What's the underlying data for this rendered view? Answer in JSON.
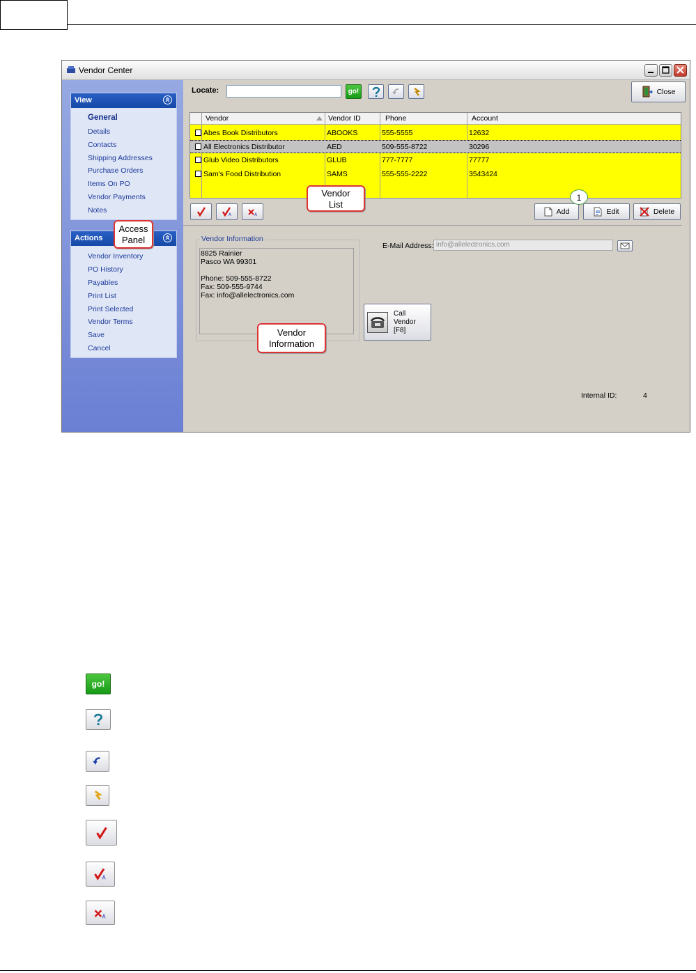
{
  "window": {
    "title": "Vendor Center"
  },
  "view_panel": {
    "title": "View",
    "items": [
      "General",
      "Details",
      "Contacts",
      "Shipping Addresses",
      "Purchase Orders",
      "Items On PO",
      "Vendor Payments",
      "Notes"
    ]
  },
  "actions_panel": {
    "title": "Actions",
    "items": [
      "Vendor Inventory",
      "PO History",
      "Payables",
      "Print List",
      "Print Selected",
      "Vendor Terms",
      "Save",
      "Cancel"
    ]
  },
  "toolbar": {
    "locate_label": "Locate:",
    "locate_value": "",
    "go_label": "go!",
    "close_label": "Close"
  },
  "vendor_grid": {
    "columns": [
      "Vendor",
      "Vendor ID",
      "Phone",
      "Account"
    ],
    "rows": [
      {
        "vendor": "Abes Book Distributors",
        "vendor_id": "ABOOKS",
        "phone": "555-5555",
        "account": "12632"
      },
      {
        "vendor": "All Electronics Distributor",
        "vendor_id": "AED",
        "phone": "509-555-8722",
        "account": "30296"
      },
      {
        "vendor": "Glub Video Distributors",
        "vendor_id": "GLUB",
        "phone": "777-7777",
        "account": "77777"
      },
      {
        "vendor": "Sam's Food Distribution",
        "vendor_id": "SAMS",
        "phone": "555-555-2222",
        "account": "3543424"
      }
    ]
  },
  "grid_buttons": {
    "add": "Add",
    "edit": "Edit",
    "delete": "Delete"
  },
  "vendor_info": {
    "legend": "Vendor Information",
    "lines": [
      "8825 Rainier",
      "Pasco WA 99301",
      "",
      "Phone: 509-555-8722",
      "Fax: 509-555-9744",
      "Fax: info@allelectronics.com"
    ]
  },
  "email": {
    "label": "E-Mail Address:",
    "value": "info@allelectronics.com"
  },
  "call_button": {
    "lines": [
      "Call",
      "Vendor",
      "[F8]"
    ]
  },
  "internal_id": {
    "label": "Internal ID:",
    "value": "4"
  },
  "callouts": {
    "access_panel": [
      "Access",
      "Panel"
    ],
    "vendor_list": [
      "Vendor",
      "List"
    ],
    "vendor_information": [
      "Vendor",
      "Information"
    ],
    "badge": "1"
  },
  "colors": {
    "grid_row": "#ffff00",
    "panel_header": "#1f55b8",
    "link_text": "#1d3a9a"
  }
}
